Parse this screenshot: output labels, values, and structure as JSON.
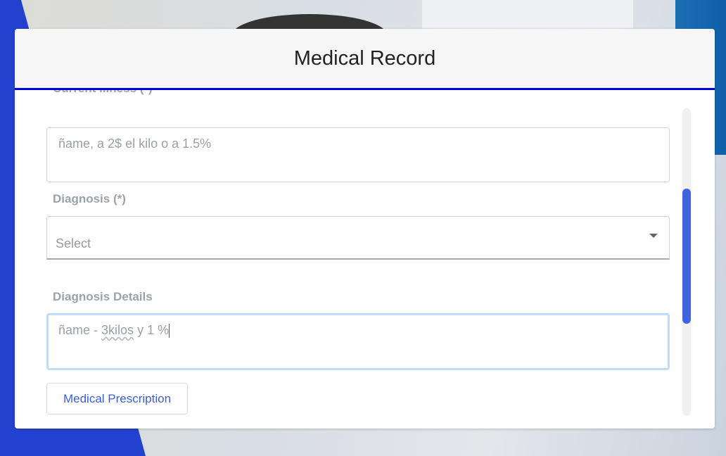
{
  "title": "Medical Record",
  "current_illness": {
    "label": "Current illness (*)",
    "value": "ñame, a 2$ el kilo o a 1.5%"
  },
  "diagnosis": {
    "label": "Diagnosis (*)",
    "placeholder": "Select"
  },
  "diagnosis_details": {
    "label": "Diagnosis Details",
    "value_prefix": "ñame - ",
    "value_misspelled": "3kilos",
    "value_suffix": " y 1 %"
  },
  "prescription_button": "Medical Prescription",
  "colors": {
    "accent": "#0000dd",
    "button_text": "#3a5de0",
    "scroll_thumb": "#3e64e0"
  }
}
